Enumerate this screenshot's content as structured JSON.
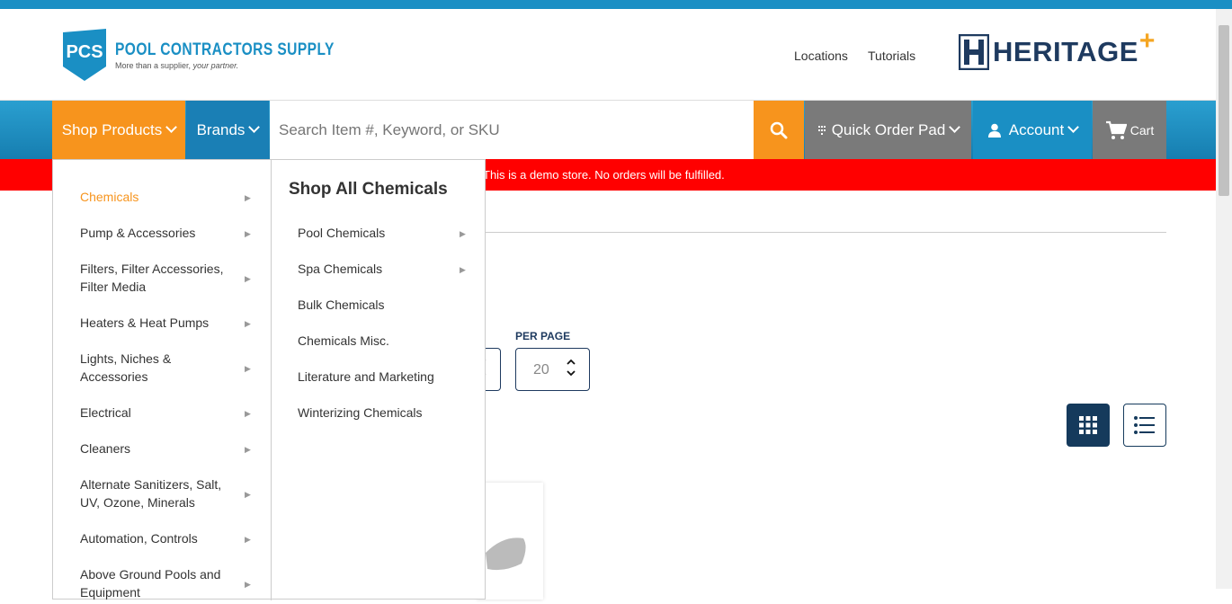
{
  "header": {
    "logo_abbr": "PCS",
    "logo_title": "POOL CONTRACTORS SUPPLY",
    "logo_tagline_plain": "More than a supplier,",
    "logo_tagline_italic": "your partner.",
    "links": [
      "Locations",
      "Tutorials"
    ],
    "partner_logo": "HERITAGE"
  },
  "nav": {
    "shop_products": "Shop Products",
    "brands": "Brands",
    "search_placeholder": "Search Item #, Keyword, or SKU",
    "quick_order": "Quick Order Pad",
    "account": "Account",
    "cart": "Cart"
  },
  "demo_banner": "This is a demo store. No orders will be fulfilled.",
  "per_page": {
    "label": "PER PAGE",
    "value": "20"
  },
  "menu": {
    "categories": [
      {
        "label": "Chemicals",
        "active": true
      },
      {
        "label": "Pump & Accessories"
      },
      {
        "label": "Filters, Filter Accessories, Filter Media"
      },
      {
        "label": "Heaters & Heat Pumps"
      },
      {
        "label": "Lights, Niches & Accessories"
      },
      {
        "label": "Electrical"
      },
      {
        "label": "Cleaners"
      },
      {
        "label": "Alternate Sanitizers, Salt, UV, Ozone, Minerals"
      },
      {
        "label": "Automation, Controls"
      },
      {
        "label": "Above Ground Pools and Equipment"
      }
    ],
    "shop_all_title": "Shop All Chemicals",
    "subcategories": [
      {
        "label": "Pool Chemicals",
        "has_children": true
      },
      {
        "label": "Spa Chemicals",
        "has_children": true
      },
      {
        "label": "Bulk Chemicals"
      },
      {
        "label": "Chemicals Misc."
      },
      {
        "label": "Literature and Marketing"
      },
      {
        "label": "Winterizing Chemicals"
      }
    ]
  },
  "colors": {
    "brand_blue": "#1a8fc4",
    "orange": "#f7941d",
    "navy": "#153a5c",
    "gray": "#7a7a7a",
    "red": "#ff0000"
  },
  "icons": [
    "search-icon",
    "grid-view-icon",
    "list-view-icon",
    "cart-icon",
    "person-icon",
    "keypad-icon"
  ]
}
